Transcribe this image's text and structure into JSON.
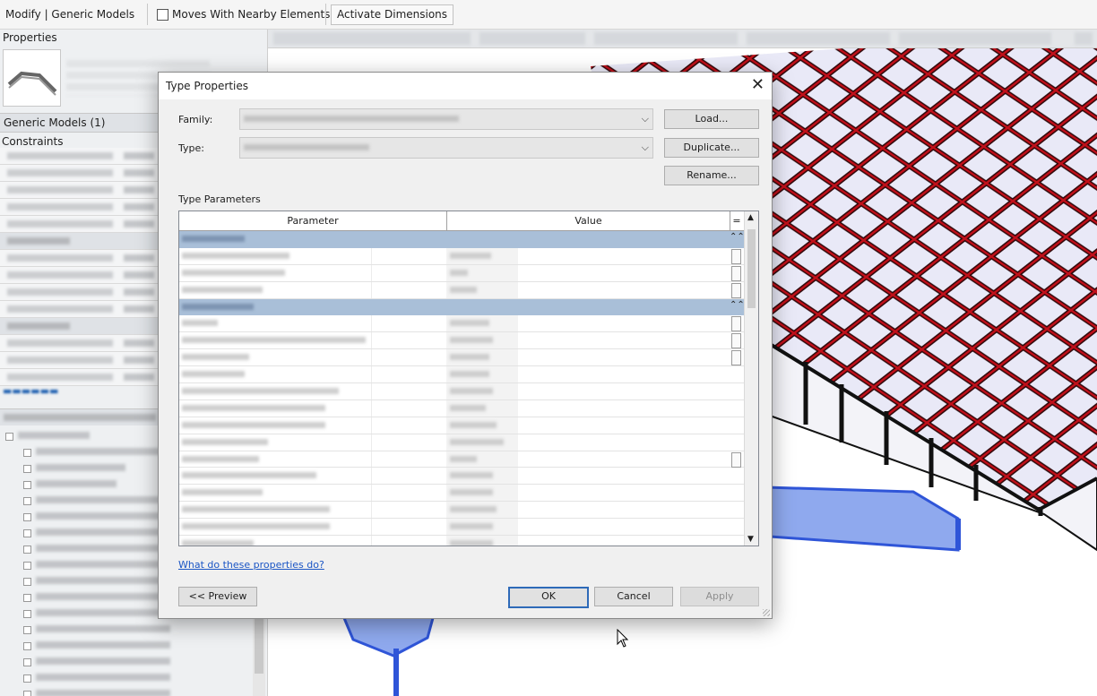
{
  "options_bar": {
    "context_label": "Modify | Generic Models",
    "moves_with_label": "Moves With Nearby Elements",
    "activate_dimensions_label": "Activate Dimensions"
  },
  "properties_panel": {
    "title": "Properties",
    "selector_label": "Generic Models (1)",
    "constraints_label": "Constraints"
  },
  "dialog": {
    "title": "Type Properties",
    "close_glyph": "✕",
    "family_label": "Family:",
    "type_label": "Type:",
    "load_label": "Load...",
    "duplicate_label": "Duplicate...",
    "rename_label": "Rename...",
    "section_label": "Type Parameters",
    "col_parameter": "Parameter",
    "col_value": "Value",
    "col_eq": "=",
    "help_link": "What do these properties do?",
    "preview_label": "<< Preview",
    "ok_label": "OK",
    "cancel_label": "Cancel",
    "apply_label": "Apply",
    "collapse_glyph": "⌃⌃"
  },
  "icons": {
    "close": "close-icon",
    "dropdown": "chevron-down-icon",
    "checkbox": "checkbox-icon",
    "cursor": "mouse-cursor-icon"
  },
  "colors": {
    "accent": "#2e6ab8",
    "group_header": "#a9bfd8",
    "frame_red": "#d4101a",
    "highlight_blue": "#3f6fe0"
  }
}
